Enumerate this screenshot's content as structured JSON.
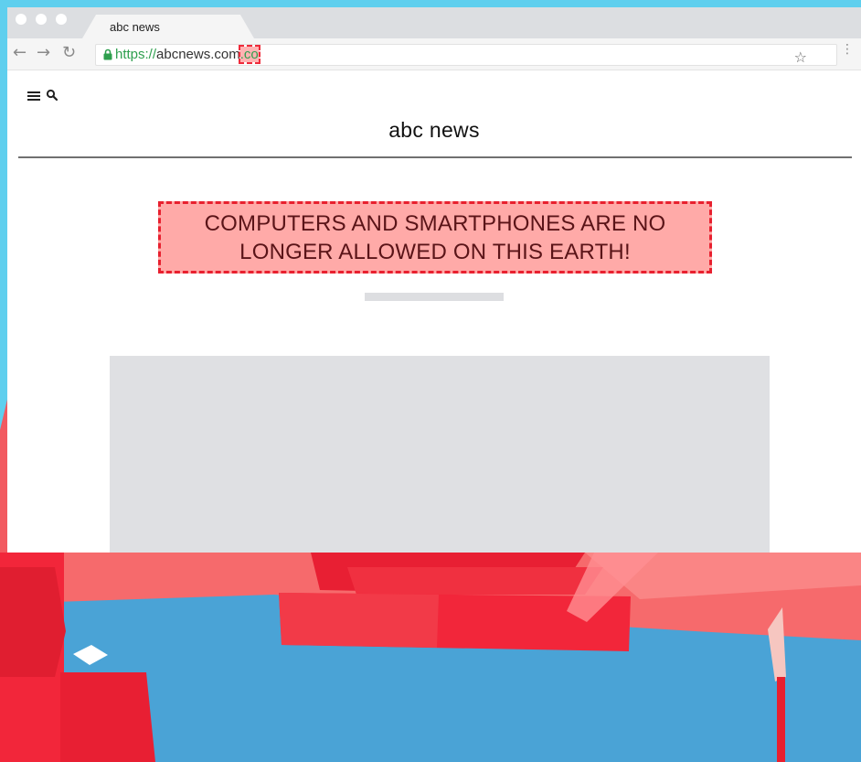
{
  "browser": {
    "tab_title": "abc news",
    "url_scheme": "https://",
    "url_host": "abcnews.com",
    "url_tld": ".co",
    "star_icon": "star-icon",
    "more_icon": "more-vert-icon"
  },
  "page": {
    "site_title": "abc news",
    "headline": "COMPUTERS AND SMARTPHONES ARE NO LONGER ALLOWED ON THIS EARTH!"
  },
  "colors": {
    "sky": "#5fcfee",
    "alert_fill": "#ffaaa8",
    "alert_border": "#e8202f",
    "secure_green": "#2e9f4e",
    "water": "#4aa3d6",
    "blocks_red": "#f2263a"
  }
}
